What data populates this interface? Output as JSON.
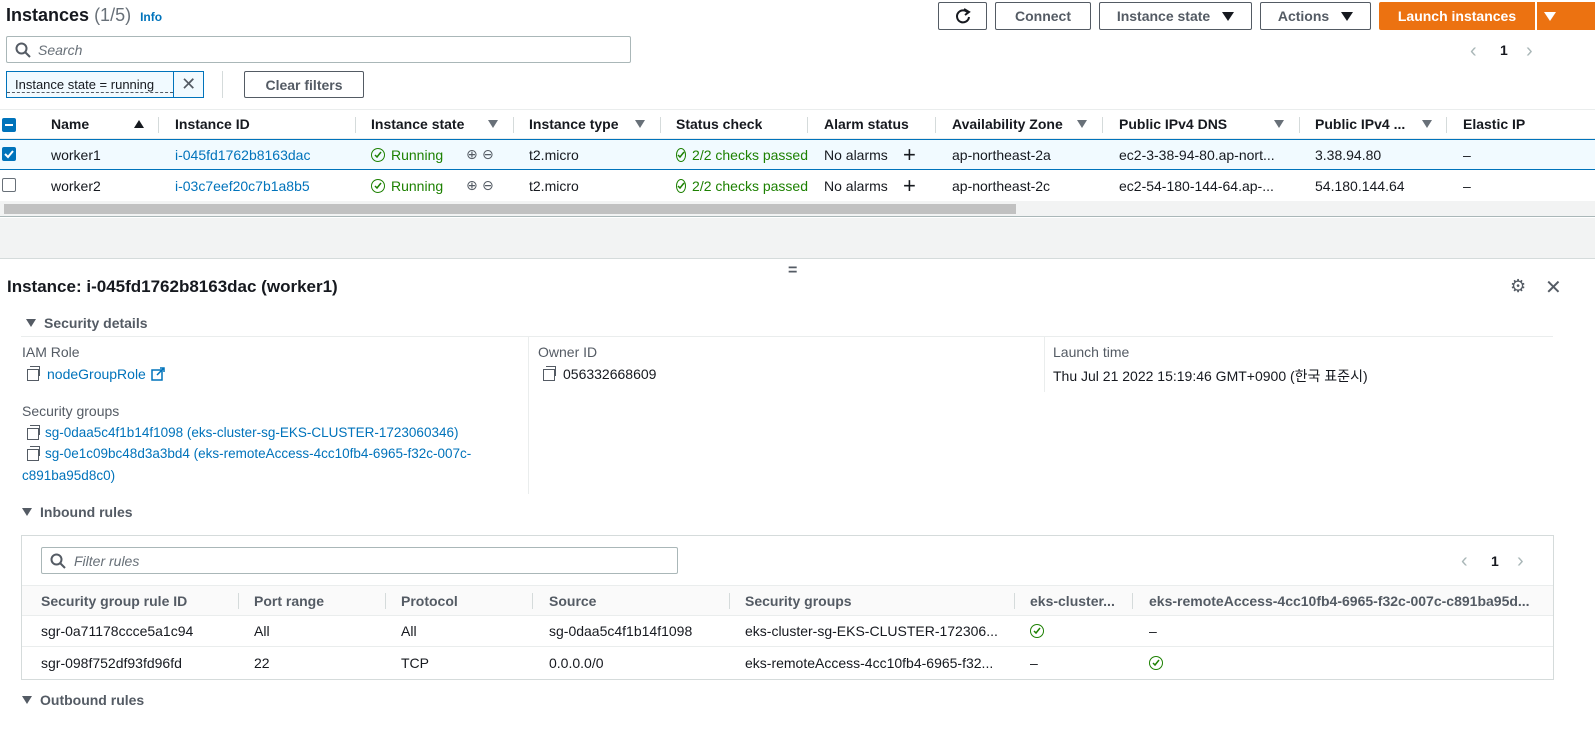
{
  "header": {
    "title": "Instances",
    "count": "(1/5)",
    "info": "Info",
    "connect": "Connect",
    "instance_state": "Instance state",
    "actions": "Actions",
    "launch": "Launch instances",
    "search_placeholder": "Search",
    "page": "1"
  },
  "filter": {
    "token": "Instance state = running",
    "clear": "Clear filters"
  },
  "table": {
    "columns": [
      "Name",
      "Instance ID",
      "Instance state",
      "Instance type",
      "Status check",
      "Alarm status",
      "Availability Zone",
      "Public IPv4 DNS",
      "Public IPv4 ...",
      "Elastic IP"
    ],
    "rows": [
      {
        "name": "worker1",
        "id": "i-045fd1762b8163dac",
        "state": "Running",
        "type": "t2.micro",
        "status": "2/2 checks passed",
        "alarm": "No alarms",
        "az": "ap-northeast-2a",
        "dns": "ec2-3-38-94-80.ap-nort...",
        "ip": "3.38.94.80",
        "eip": "–",
        "selected": true
      },
      {
        "name": "worker2",
        "id": "i-03c7eef20c7b1a8b5",
        "state": "Running",
        "type": "t2.micro",
        "status": "2/2 checks passed",
        "alarm": "No alarms",
        "az": "ap-northeast-2c",
        "dns": "ec2-54-180-144-64.ap-...",
        "ip": "54.180.144.64",
        "eip": "–",
        "selected": false
      }
    ]
  },
  "details": {
    "title": "Instance: i-045fd1762b8163dac (worker1)",
    "security_details": "Security details",
    "iam_role_label": "IAM Role",
    "iam_role": "nodeGroupRole",
    "owner_label": "Owner ID",
    "owner": "056332668609",
    "launch_label": "Launch time",
    "launch": "Thu Jul 21 2022 15:19:46 GMT+0900 (한국 표준시)",
    "sg_label": "Security groups",
    "sg1": "sg-0daa5c4f1b14f1098 (eks-cluster-sg-EKS-CLUSTER-1723060346)",
    "sg2_a": "sg-0e1c09bc48d3a3bd4 (eks-remoteAccess-4cc10fb4-6965-f32c-007c-",
    "sg2_b": "c891ba95d8c0)",
    "inbound": "Inbound rules",
    "outbound": "Outbound rules",
    "filter_placeholder": "Filter rules",
    "page": "1"
  },
  "inbound_table": {
    "columns": [
      "Security group rule ID",
      "Port range",
      "Protocol",
      "Source",
      "Security groups",
      "eks-cluster...",
      "eks-remoteAccess-4cc10fb4-6965-f32c-007c-c891ba95d..."
    ],
    "rows": [
      {
        "id": "sgr-0a71178ccce5a1c94",
        "port": "All",
        "protocol": "All",
        "source": "sg-0daa5c4f1b14f1098",
        "sg": "eks-cluster-sg-EKS-CLUSTER-172306...",
        "c1": "check",
        "c2": "–"
      },
      {
        "id": "sgr-098f752df93fd96fd",
        "port": "22",
        "protocol": "TCP",
        "source": "0.0.0.0/0",
        "sg": "eks-remoteAccess-4cc10fb4-6965-f32...",
        "c1": "–",
        "c2": "check"
      }
    ]
  }
}
